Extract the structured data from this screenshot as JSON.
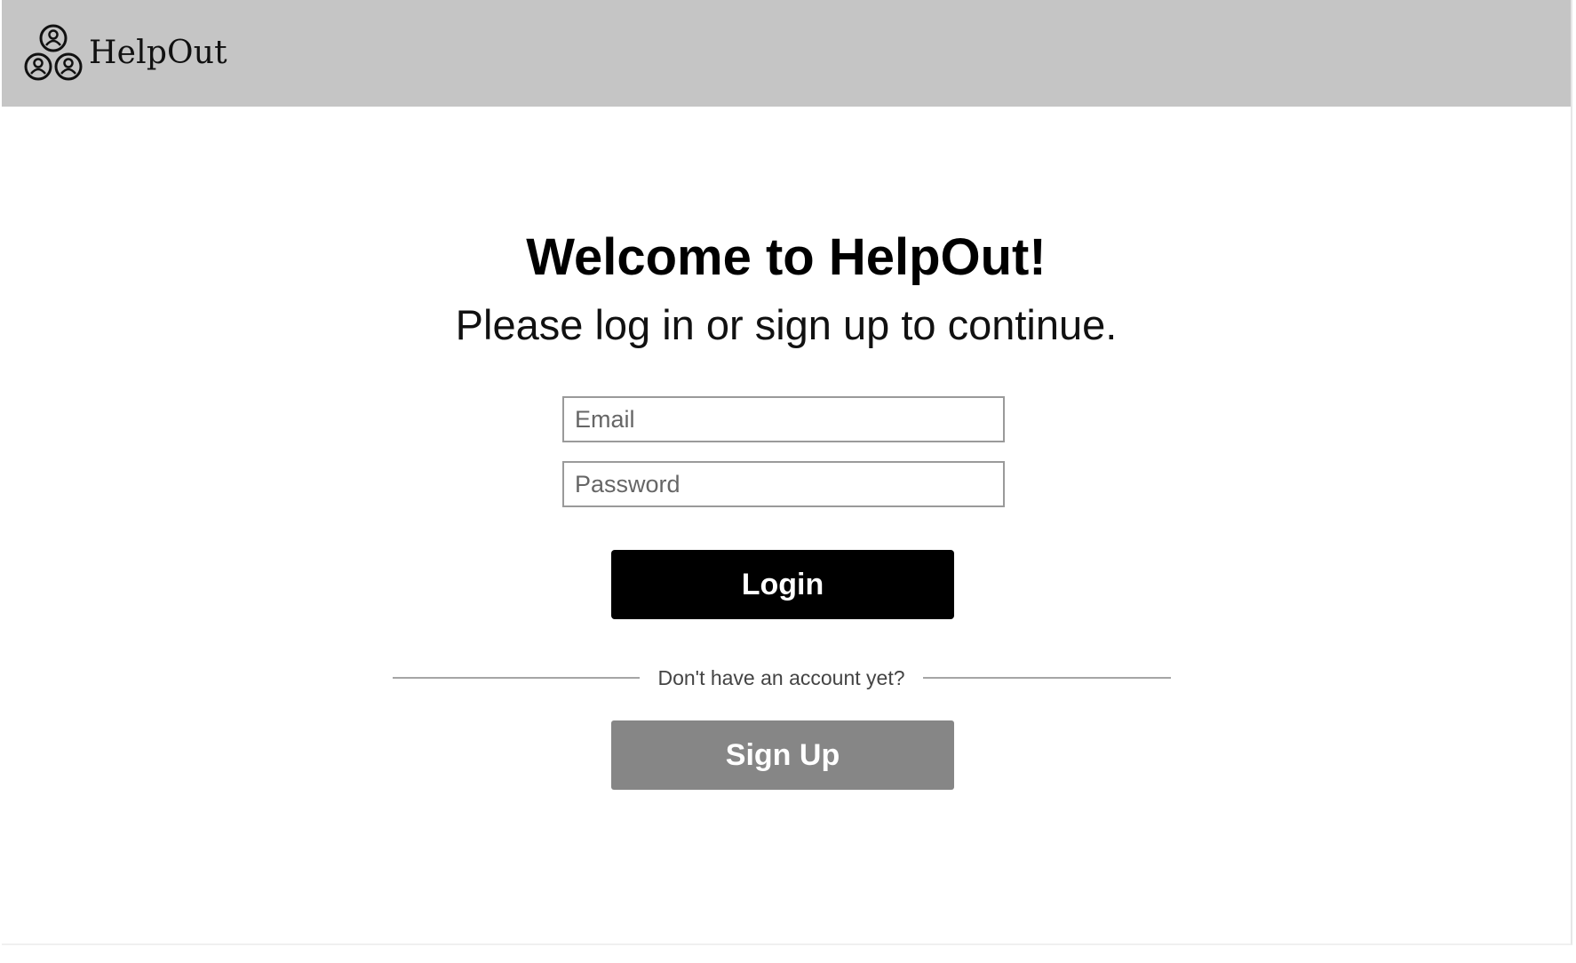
{
  "header": {
    "brand": "HelpOut",
    "logo_icon": "three-people-circles-icon",
    "background_color": "#c5c5c5"
  },
  "main": {
    "title": "Welcome to HelpOut!",
    "subtitle": "Please log in or sign up to continue.",
    "email": {
      "placeholder": "Email",
      "value": ""
    },
    "password": {
      "placeholder": "Password",
      "value": ""
    },
    "login_label": "Login",
    "divider_text": "Don't have an account yet?",
    "signup_label": "Sign Up"
  },
  "colors": {
    "login_button": "#000000",
    "signup_button": "#868686",
    "divider": "#a5a5a5"
  }
}
